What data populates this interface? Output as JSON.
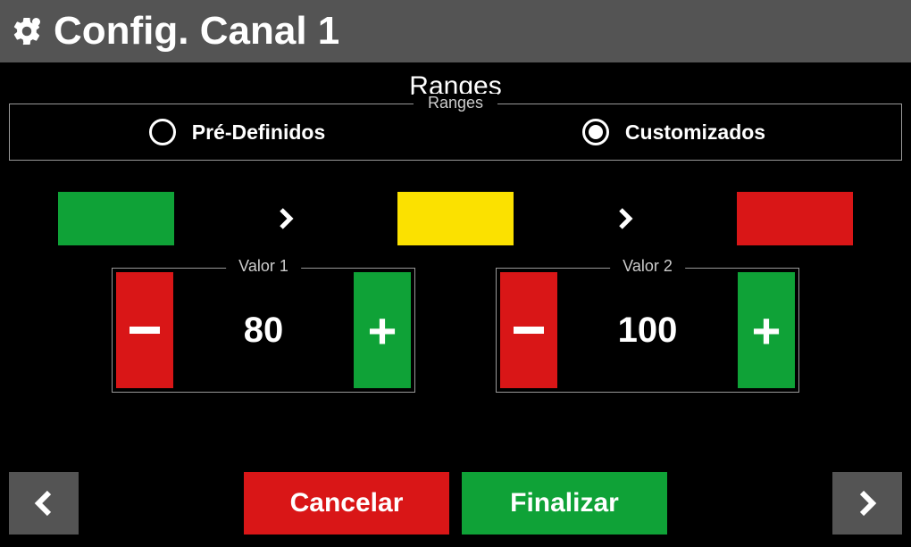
{
  "header": {
    "title": "Config. Canal 1"
  },
  "section": {
    "title": "Ranges",
    "fieldset_legend": "Ranges"
  },
  "radios": {
    "predefined": "Pré-Definidos",
    "custom": "Customizados"
  },
  "values": {
    "label1": "Valor 1",
    "val1": "80",
    "label2": "Valor 2",
    "val2": "100"
  },
  "footer": {
    "cancel": "Cancelar",
    "finish": "Finalizar"
  }
}
